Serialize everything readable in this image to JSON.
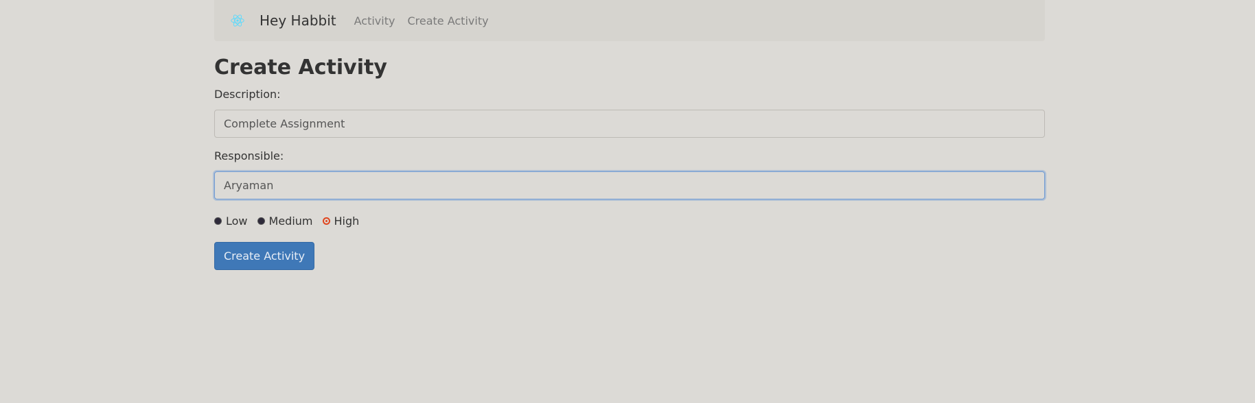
{
  "navbar": {
    "brand_icon": "react-logo-icon",
    "brand_name": "Hey Habbit",
    "links": [
      "Activity",
      "Create Activity"
    ]
  },
  "form": {
    "title": "Create Activity",
    "description_label": "Description:",
    "description_value": "Complete Assignment",
    "responsible_label": "Responsible:",
    "responsible_value": "Aryaman",
    "priority_options": [
      "Low",
      "Medium",
      "High"
    ],
    "priority_selected": "High",
    "submit_label": "Create Activity"
  },
  "colors": {
    "background": "#dcdad6",
    "navbar": "#d6d4cf",
    "primary_button": "#3f78b7",
    "radio_checked": "#e0461f",
    "logo": "#61dafb"
  }
}
